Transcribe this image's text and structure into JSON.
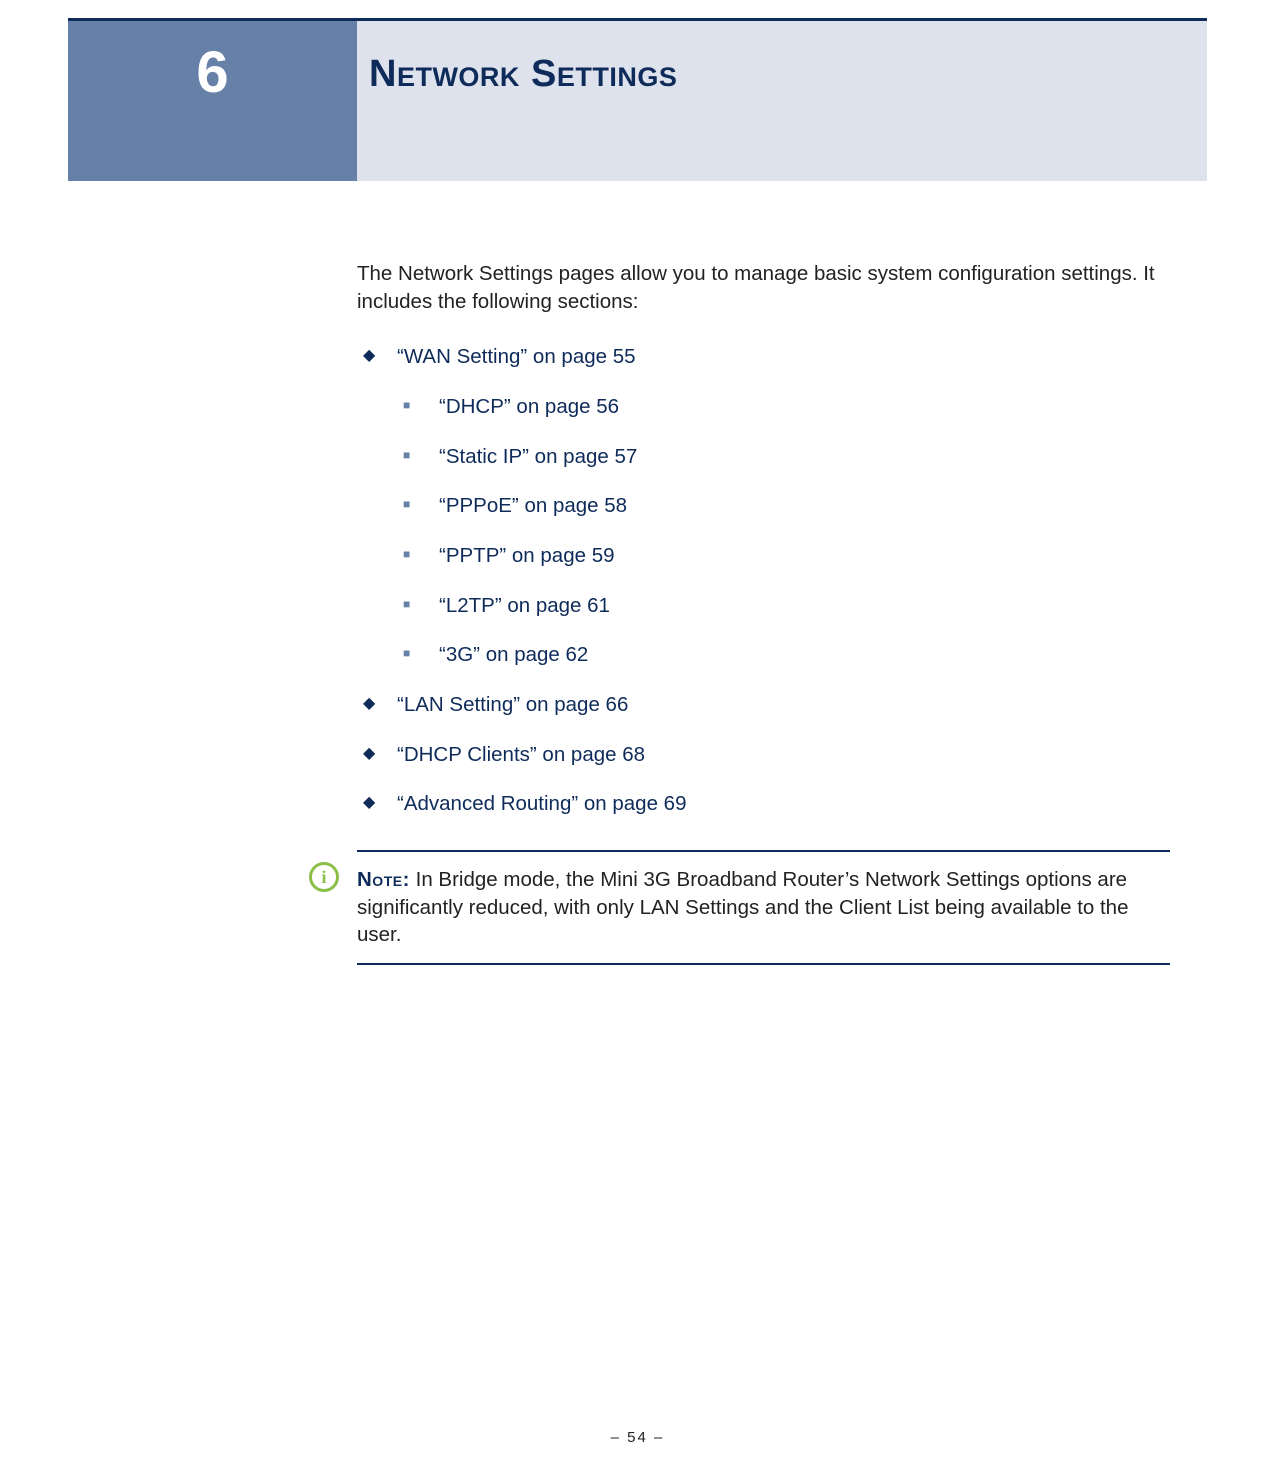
{
  "chapter": {
    "number": "6",
    "title": "Network Settings"
  },
  "intro": "The Network Settings pages allow you to manage basic system configuration settings. It includes the following sections:",
  "toc": [
    {
      "label": "“WAN Setting” on page 55",
      "children": [
        {
          "label": "“DHCP” on page 56"
        },
        {
          "label": "“Static IP” on page 57"
        },
        {
          "label": "“PPPoE” on page 58"
        },
        {
          "label": "“PPTP” on page 59"
        },
        {
          "label": "“L2TP” on page 61"
        },
        {
          "label": "“3G” on page 62"
        }
      ]
    },
    {
      "label": "“LAN Setting” on page 66"
    },
    {
      "label": "“DHCP Clients” on page 68"
    },
    {
      "label": "“Advanced Routing” on page 69"
    }
  ],
  "note": {
    "label": "Note:",
    "text": " In Bridge mode, the Mini 3G Broadband Router’s Network Settings options are significantly reduced, with only LAN Settings and the Client List being available to the user."
  },
  "footer": {
    "page": "–  54  –"
  }
}
